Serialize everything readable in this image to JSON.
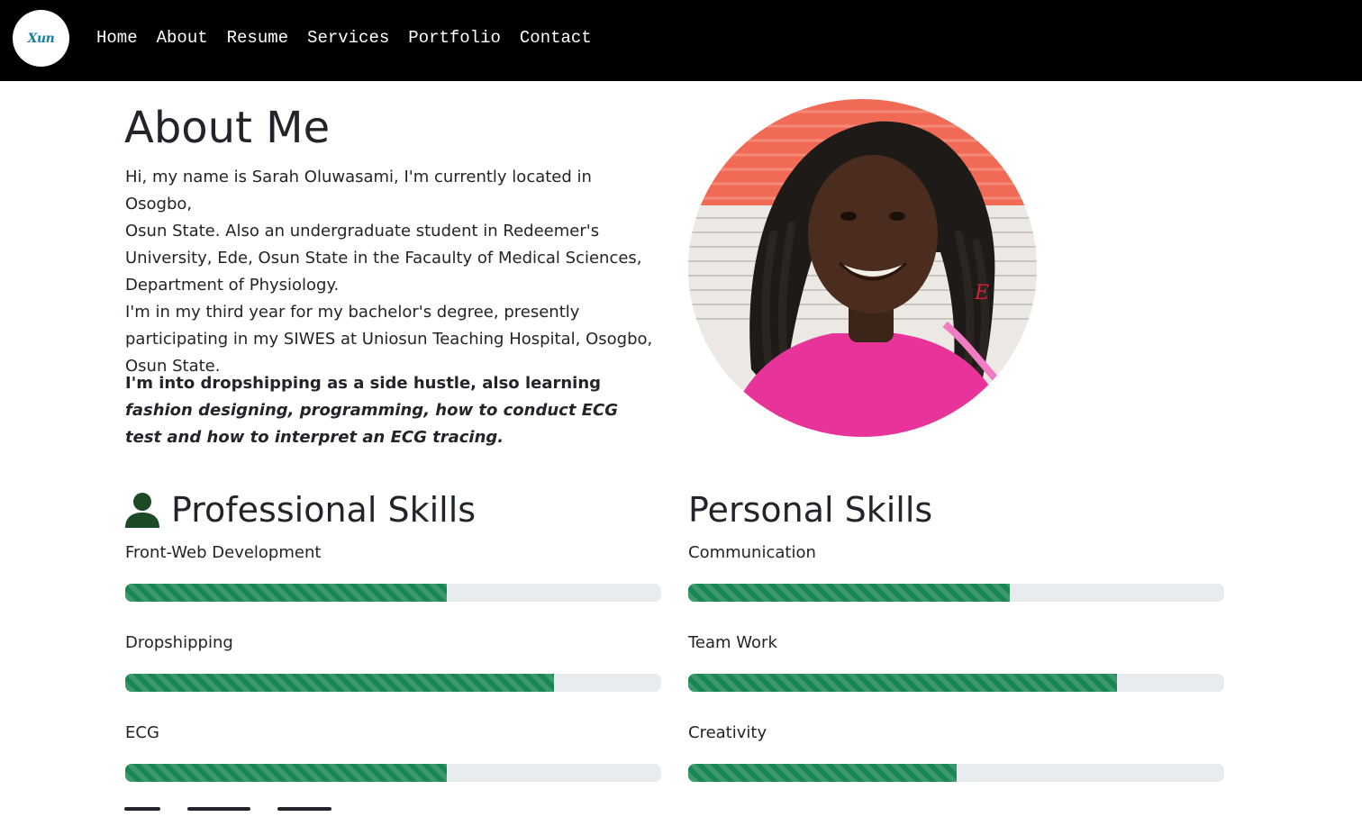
{
  "nav": {
    "logo_text": "Xun",
    "links": [
      "Home",
      "About",
      "Resume",
      "Services",
      "Portfolio",
      "Contact"
    ]
  },
  "about": {
    "title": "About Me",
    "bio_lines": [
      "Hi, my name is Sarah Oluwasami, I'm currently located in Osogbo,",
      "Osun State. Also an undergraduate student in Redeemer's",
      "University, Ede, Osun State in the Facaulty of Medical Sciences,",
      "Department of Physiology.",
      "I'm in my third year for my bachelor's degree, presently",
      "participating in my SIWES at Uniosun Teaching Hospital, Osogbo,",
      "Osun State."
    ],
    "highlight_plain": "I'm into dropshipping as a side hustle, also learning ",
    "highlight_italic": "fashion designing, programming, how to conduct ECG test and how to interpret an ECG tracing."
  },
  "professional": {
    "heading": "Professional Skills",
    "skills": [
      {
        "label": "Front-Web Development",
        "percent": 60
      },
      {
        "label": "Dropshipping",
        "percent": 80
      },
      {
        "label": "ECG",
        "percent": 60
      }
    ]
  },
  "personal": {
    "heading": "Personal Skills",
    "skills": [
      {
        "label": "Communication",
        "percent": 60
      },
      {
        "label": "Team Work",
        "percent": 80
      },
      {
        "label": "Creativity",
        "percent": 50
      }
    ]
  },
  "colors": {
    "progress": "#198754",
    "track": "#e9ecef",
    "nav_bg": "#000000"
  }
}
